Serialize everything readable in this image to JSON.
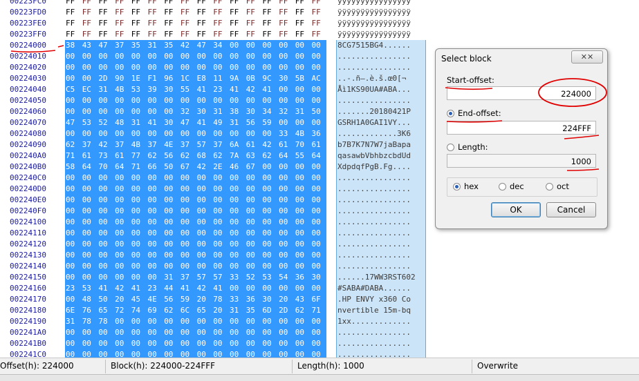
{
  "hex_rows": [
    {
      "offset": "00223FC0",
      "bytes": [
        "FF",
        "FF",
        "FF",
        "FF",
        "FF",
        "FF",
        "FF",
        "FF",
        "FF",
        "FF",
        "FF",
        "FF",
        "FF",
        "FF",
        "FF",
        "FF"
      ],
      "ascii": "ÿÿÿÿÿÿÿÿÿÿÿÿÿÿÿÿ",
      "selected": false
    },
    {
      "offset": "00223FD0",
      "bytes": [
        "FF",
        "FF",
        "FF",
        "FF",
        "FF",
        "FF",
        "FF",
        "FF",
        "FF",
        "FF",
        "FF",
        "FF",
        "FF",
        "FF",
        "FF",
        "FF"
      ],
      "ascii": "ÿÿÿÿÿÿÿÿÿÿÿÿÿÿÿÿ",
      "selected": false
    },
    {
      "offset": "00223FE0",
      "bytes": [
        "FF",
        "FF",
        "FF",
        "FF",
        "FF",
        "FF",
        "FF",
        "FF",
        "FF",
        "FF",
        "FF",
        "FF",
        "FF",
        "FF",
        "FF",
        "FF"
      ],
      "ascii": "ÿÿÿÿÿÿÿÿÿÿÿÿÿÿÿÿ",
      "selected": false
    },
    {
      "offset": "00223FF0",
      "bytes": [
        "FF",
        "FF",
        "FF",
        "FF",
        "FF",
        "FF",
        "FF",
        "FF",
        "FF",
        "FF",
        "FF",
        "FF",
        "FF",
        "FF",
        "FF",
        "FF"
      ],
      "ascii": "ÿÿÿÿÿÿÿÿÿÿÿÿÿÿÿÿ",
      "selected": false
    },
    {
      "offset": "00224000",
      "bytes": [
        "38",
        "43",
        "47",
        "37",
        "35",
        "31",
        "35",
        "42",
        "47",
        "34",
        "00",
        "00",
        "00",
        "00",
        "00",
        "00"
      ],
      "ascii": "8CG7515BG4......",
      "selected": true
    },
    {
      "offset": "00224010",
      "bytes": [
        "00",
        "00",
        "00",
        "00",
        "00",
        "00",
        "00",
        "00",
        "00",
        "00",
        "00",
        "00",
        "00",
        "00",
        "00",
        "00"
      ],
      "ascii": "................",
      "selected": true
    },
    {
      "offset": "00224020",
      "bytes": [
        "00",
        "00",
        "00",
        "00",
        "00",
        "00",
        "00",
        "00",
        "00",
        "00",
        "00",
        "00",
        "00",
        "00",
        "00",
        "00"
      ],
      "ascii": "................",
      "selected": true
    },
    {
      "offset": "00224030",
      "bytes": [
        "00",
        "00",
        "2D",
        "90",
        "1E",
        "F1",
        "96",
        "1C",
        "E8",
        "11",
        "9A",
        "0B",
        "9C",
        "30",
        "5B",
        "AC"
      ],
      "ascii": "..-.ñ–.è.š.œ0[¬",
      "selected": true
    },
    {
      "offset": "00224040",
      "bytes": [
        "C5",
        "EC",
        "31",
        "4B",
        "53",
        "39",
        "30",
        "55",
        "41",
        "23",
        "41",
        "42",
        "41",
        "00",
        "00",
        "00"
      ],
      "ascii": "Åì1KS90UA#ABA...",
      "selected": true
    },
    {
      "offset": "00224050",
      "bytes": [
        "00",
        "00",
        "00",
        "00",
        "00",
        "00",
        "00",
        "00",
        "00",
        "00",
        "00",
        "00",
        "00",
        "00",
        "00",
        "00"
      ],
      "ascii": "................",
      "selected": true
    },
    {
      "offset": "00224060",
      "bytes": [
        "00",
        "00",
        "00",
        "00",
        "00",
        "00",
        "00",
        "32",
        "30",
        "31",
        "38",
        "30",
        "34",
        "32",
        "31",
        "50"
      ],
      "ascii": ".......20180421P",
      "selected": true
    },
    {
      "offset": "00224070",
      "bytes": [
        "47",
        "53",
        "52",
        "48",
        "31",
        "41",
        "30",
        "47",
        "41",
        "49",
        "31",
        "56",
        "59",
        "00",
        "00",
        "00"
      ],
      "ascii": "GSRH1A0GAI1VY...",
      "selected": true
    },
    {
      "offset": "00224080",
      "bytes": [
        "00",
        "00",
        "00",
        "00",
        "00",
        "00",
        "00",
        "00",
        "00",
        "00",
        "00",
        "00",
        "00",
        "33",
        "4B",
        "36"
      ],
      "ascii": ".............3K6",
      "selected": true
    },
    {
      "offset": "00224090",
      "bytes": [
        "62",
        "37",
        "42",
        "37",
        "4B",
        "37",
        "4E",
        "37",
        "57",
        "37",
        "6A",
        "61",
        "42",
        "61",
        "70",
        "61"
      ],
      "ascii": "b7B7K7N7W7jaBapa",
      "selected": true
    },
    {
      "offset": "002240A0",
      "bytes": [
        "71",
        "61",
        "73",
        "61",
        "77",
        "62",
        "56",
        "62",
        "68",
        "62",
        "7A",
        "63",
        "62",
        "64",
        "55",
        "64"
      ],
      "ascii": "qasawbVbhbzcbdUd",
      "selected": true
    },
    {
      "offset": "002240B0",
      "bytes": [
        "58",
        "64",
        "70",
        "64",
        "71",
        "66",
        "50",
        "67",
        "42",
        "2E",
        "46",
        "67",
        "00",
        "00",
        "00",
        "00"
      ],
      "ascii": "XdpdqfPgB.Fg....",
      "selected": true
    },
    {
      "offset": "002240C0",
      "bytes": [
        "00",
        "00",
        "00",
        "00",
        "00",
        "00",
        "00",
        "00",
        "00",
        "00",
        "00",
        "00",
        "00",
        "00",
        "00",
        "00"
      ],
      "ascii": "................",
      "selected": true
    },
    {
      "offset": "002240D0",
      "bytes": [
        "00",
        "00",
        "00",
        "00",
        "00",
        "00",
        "00",
        "00",
        "00",
        "00",
        "00",
        "00",
        "00",
        "00",
        "00",
        "00"
      ],
      "ascii": "................",
      "selected": true
    },
    {
      "offset": "002240E0",
      "bytes": [
        "00",
        "00",
        "00",
        "00",
        "00",
        "00",
        "00",
        "00",
        "00",
        "00",
        "00",
        "00",
        "00",
        "00",
        "00",
        "00"
      ],
      "ascii": "................",
      "selected": true
    },
    {
      "offset": "002240F0",
      "bytes": [
        "00",
        "00",
        "00",
        "00",
        "00",
        "00",
        "00",
        "00",
        "00",
        "00",
        "00",
        "00",
        "00",
        "00",
        "00",
        "00"
      ],
      "ascii": "................",
      "selected": true
    },
    {
      "offset": "00224100",
      "bytes": [
        "00",
        "00",
        "00",
        "00",
        "00",
        "00",
        "00",
        "00",
        "00",
        "00",
        "00",
        "00",
        "00",
        "00",
        "00",
        "00"
      ],
      "ascii": "................",
      "selected": true
    },
    {
      "offset": "00224110",
      "bytes": [
        "00",
        "00",
        "00",
        "00",
        "00",
        "00",
        "00",
        "00",
        "00",
        "00",
        "00",
        "00",
        "00",
        "00",
        "00",
        "00"
      ],
      "ascii": "................",
      "selected": true
    },
    {
      "offset": "00224120",
      "bytes": [
        "00",
        "00",
        "00",
        "00",
        "00",
        "00",
        "00",
        "00",
        "00",
        "00",
        "00",
        "00",
        "00",
        "00",
        "00",
        "00"
      ],
      "ascii": "................",
      "selected": true
    },
    {
      "offset": "00224130",
      "bytes": [
        "00",
        "00",
        "00",
        "00",
        "00",
        "00",
        "00",
        "00",
        "00",
        "00",
        "00",
        "00",
        "00",
        "00",
        "00",
        "00"
      ],
      "ascii": "................",
      "selected": true
    },
    {
      "offset": "00224140",
      "bytes": [
        "00",
        "00",
        "00",
        "00",
        "00",
        "00",
        "00",
        "00",
        "00",
        "00",
        "00",
        "00",
        "00",
        "00",
        "00",
        "00"
      ],
      "ascii": "................",
      "selected": true
    },
    {
      "offset": "00224150",
      "bytes": [
        "00",
        "00",
        "00",
        "00",
        "00",
        "00",
        "31",
        "37",
        "57",
        "57",
        "33",
        "52",
        "53",
        "54",
        "36",
        "30",
        "32"
      ],
      "ascii": "......17WW3RST602",
      "selected": true
    },
    {
      "offset": "00224160",
      "bytes": [
        "23",
        "53",
        "41",
        "42",
        "41",
        "23",
        "44",
        "41",
        "42",
        "41",
        "00",
        "00",
        "00",
        "00",
        "00",
        "00"
      ],
      "ascii": "#SABA#DABA......",
      "selected": true
    },
    {
      "offset": "00224170",
      "bytes": [
        "00",
        "48",
        "50",
        "20",
        "45",
        "4E",
        "56",
        "59",
        "20",
        "78",
        "33",
        "36",
        "30",
        "20",
        "43",
        "6F"
      ],
      "ascii": ".HP ENVY x360 Co",
      "selected": true
    },
    {
      "offset": "00224180",
      "bytes": [
        "6E",
        "76",
        "65",
        "72",
        "74",
        "69",
        "62",
        "6C",
        "65",
        "20",
        "31",
        "35",
        "6D",
        "2D",
        "62",
        "71"
      ],
      "ascii": "nvertible 15m-bq",
      "selected": true
    },
    {
      "offset": "00224190",
      "bytes": [
        "31",
        "78",
        "78",
        "00",
        "00",
        "00",
        "00",
        "00",
        "00",
        "00",
        "00",
        "00",
        "00",
        "00",
        "00",
        "00"
      ],
      "ascii": "1xx.............",
      "selected": true
    },
    {
      "offset": "002241A0",
      "bytes": [
        "00",
        "00",
        "00",
        "00",
        "00",
        "00",
        "00",
        "00",
        "00",
        "00",
        "00",
        "00",
        "00",
        "00",
        "00",
        "00"
      ],
      "ascii": "................",
      "selected": true
    },
    {
      "offset": "002241B0",
      "bytes": [
        "00",
        "00",
        "00",
        "00",
        "00",
        "00",
        "00",
        "00",
        "00",
        "00",
        "00",
        "00",
        "00",
        "00",
        "00",
        "00"
      ],
      "ascii": "................",
      "selected": true
    },
    {
      "offset": "002241C0",
      "bytes": [
        "00",
        "00",
        "00",
        "00",
        "00",
        "00",
        "00",
        "00",
        "00",
        "00",
        "00",
        "00",
        "00",
        "00",
        "00",
        "00"
      ],
      "ascii": "................",
      "selected": true
    }
  ],
  "dialog": {
    "title": "Select block",
    "close_label": "✕✕",
    "start_label": "Start-offset:",
    "start_value": "224000",
    "end_label": "End-offset:",
    "end_value": "224FFF",
    "length_label": "Length:",
    "length_value": "1000",
    "radio_hex": "hex",
    "radio_dec": "dec",
    "radio_oct": "oct",
    "ok_label": "OK",
    "cancel_label": "Cancel"
  },
  "status": {
    "offset": "Offset(h): 224000",
    "block": "Block(h): 224000-224FFF",
    "length": "Length(h): 1000",
    "mode": "Overwrite"
  },
  "colors": {
    "selection": "#3399ff",
    "annotation": "#e00000"
  }
}
